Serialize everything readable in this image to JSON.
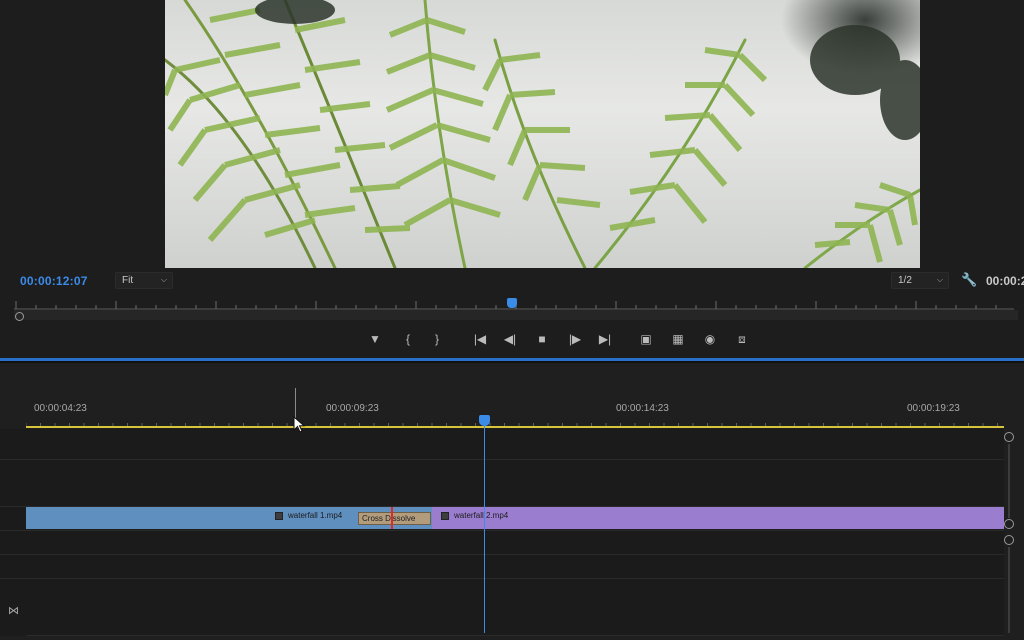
{
  "monitor": {
    "timecode_current": "00:00:12:07",
    "zoom_select": "Fit",
    "resolution_select": "1/2",
    "timecode_duration": "00:00:2"
  },
  "transport": {
    "buttons": [
      "add-marker",
      "mark-in",
      "mark-out",
      "go-to-in",
      "step-back",
      "stop",
      "step-forward",
      "go-to-out",
      "insert",
      "overwrite",
      "export-frame",
      "compare-view"
    ]
  },
  "timeline": {
    "time_labels": [
      "00:00:04:23",
      "00:00:09:23",
      "00:00:14:23",
      "00:00:19:23"
    ],
    "clips": {
      "clip_a": "waterfall 1.mp4",
      "clip_b": "waterfall 2.mp4",
      "transition": "Cross Dissolve"
    }
  },
  "colors": {
    "accent": "#3b8be8",
    "clip_a": "#5f8fbf",
    "clip_b": "#9b7dd0",
    "transition": "#b39c7c",
    "work_area": "#d8c43a",
    "cut": "#e02a2a"
  }
}
